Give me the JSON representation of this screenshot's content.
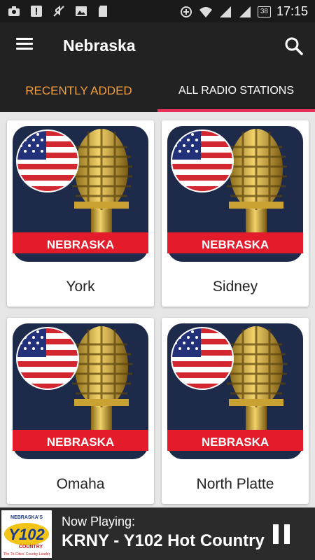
{
  "status_bar": {
    "time": "17:15",
    "battery": "38",
    "icons": [
      "camera-icon",
      "alert-icon",
      "mute-icon",
      "image-icon",
      "sd-card-icon",
      "data-saver-icon",
      "wifi-icon",
      "signal-icon",
      "signal-icon"
    ]
  },
  "app_bar": {
    "title": "Nebraska",
    "icons": [
      "menu-icon",
      "search-icon"
    ]
  },
  "tabs": [
    {
      "label": "RECENTLY ADDED",
      "active": false
    },
    {
      "label": "ALL RADIO STATIONS",
      "active": true
    }
  ],
  "colors": {
    "app_bar": "#222222",
    "tab_active_indicator": "#e8325a",
    "tab_recent_text": "#f0a040",
    "banner_red": "#e31b2a",
    "mic_gold": "#d8b23c"
  },
  "stations": [
    {
      "name": "York",
      "banner": "NEBRASKA"
    },
    {
      "name": "Sidney",
      "banner": "NEBRASKA"
    },
    {
      "name": "Omaha",
      "banner": "NEBRASKA"
    },
    {
      "name": "North Platte",
      "banner": "NEBRASKA"
    }
  ],
  "player": {
    "now_playing_label": "Now Playing:",
    "station": "KRNY - Y102 Hot Country",
    "logo_text": "Y102",
    "logo_subtext": "NEBRASKA'S",
    "logo_tagline": "COUNTRY",
    "logo_footer": "The Tri-Cities' Country Leader",
    "icons": [
      "station-logo",
      "pause-icon"
    ]
  }
}
